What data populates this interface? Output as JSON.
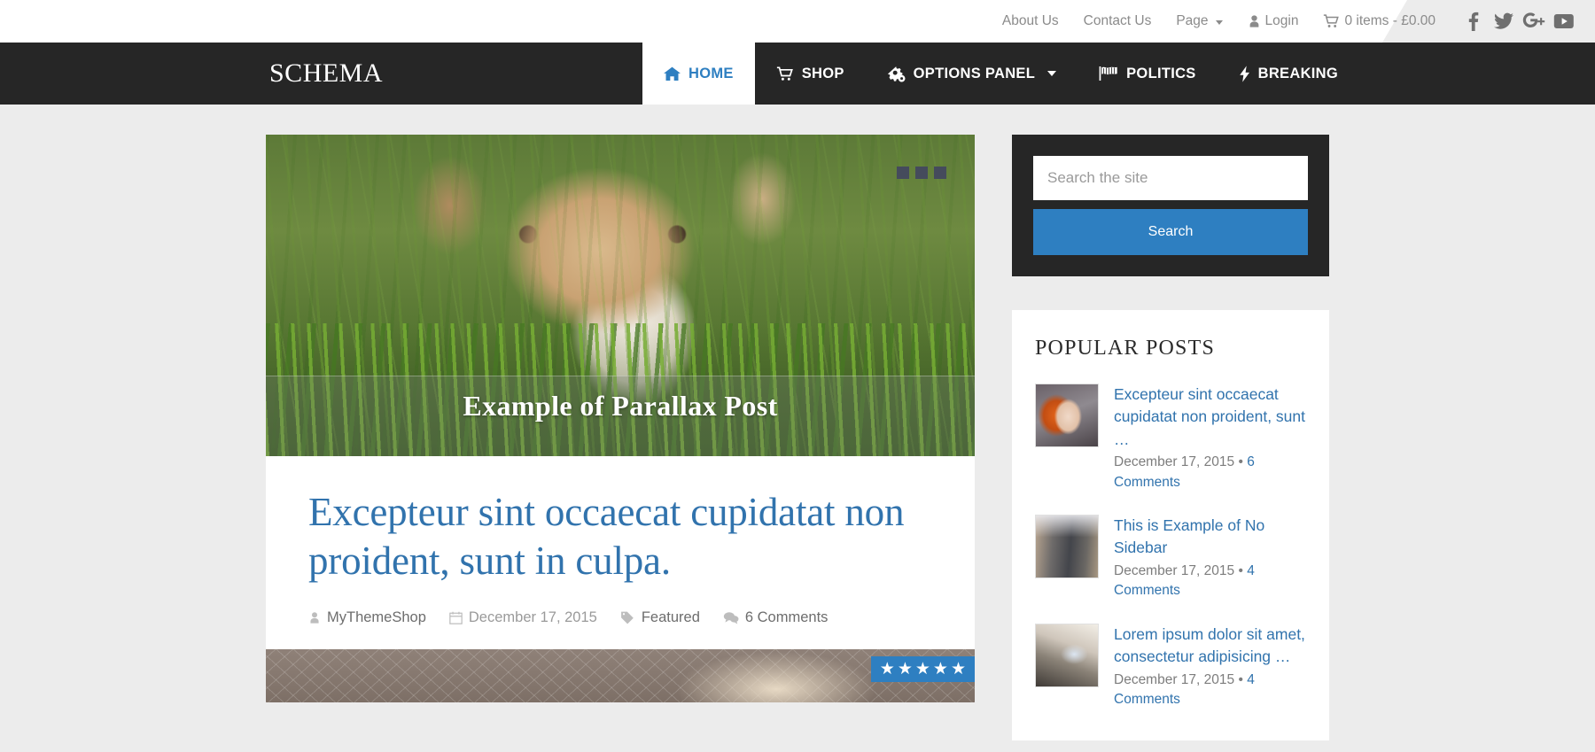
{
  "topbar": {
    "links": [
      {
        "label": "About Us",
        "icon": "",
        "caret": false
      },
      {
        "label": "Contact Us",
        "icon": "",
        "caret": false
      },
      {
        "label": "Page",
        "icon": "",
        "caret": true
      },
      {
        "label": "Login",
        "icon": "user-icon",
        "caret": false
      },
      {
        "label": "0 items - £0.00",
        "icon": "cart-icon",
        "caret": false
      }
    ],
    "social": [
      {
        "name": "facebook-icon",
        "label": "Facebook"
      },
      {
        "name": "twitter-icon",
        "label": "Twitter"
      },
      {
        "name": "google-plus-icon",
        "label": "Google Plus"
      },
      {
        "name": "youtube-icon",
        "label": "YouTube"
      }
    ]
  },
  "nav": {
    "logo": "SCHEMA",
    "items": [
      {
        "label": "HOME",
        "icon": "home-icon",
        "active": true,
        "caret": false
      },
      {
        "label": "SHOP",
        "icon": "cart-icon",
        "active": false,
        "caret": false
      },
      {
        "label": "OPTIONS PANEL",
        "icon": "gears-icon",
        "active": false,
        "caret": true
      },
      {
        "label": "POLITICS",
        "icon": "flag-icon",
        "active": false,
        "caret": false
      },
      {
        "label": "BREAKING",
        "icon": "bolt-icon",
        "active": false,
        "caret": false
      }
    ]
  },
  "hero": {
    "title": "Example of Parallax Post",
    "slider_dots": 3
  },
  "article": {
    "title": "Excepteur sint occaecat cupidatat non proident, sunt in culpa.",
    "meta": {
      "author": "MyThemeShop",
      "date": "December 17, 2015",
      "category": "Featured",
      "comments": "6 Comments"
    },
    "rating_stars": 5,
    "rating_star_glyph": "★"
  },
  "sidebar": {
    "search": {
      "placeholder": "Search the site",
      "value": "",
      "button_label": "Search"
    },
    "popular": {
      "heading": "POPULAR POSTS",
      "items": [
        {
          "title": "Excepteur sint occaecat cupidatat non proident, sunt …",
          "date": "December 17, 2015",
          "separator": "•",
          "comments": "6 Comments",
          "thumb": "woman-portrait"
        },
        {
          "title": "This is Example of No Sidebar",
          "date": "December 17, 2015",
          "separator": "•",
          "comments": "4 Comments",
          "thumb": "bridge-walkway"
        },
        {
          "title": "Lorem ipsum dolor sit amet, consectetur adipisicing …",
          "date": "December 17, 2015",
          "separator": "•",
          "comments": "4 Comments",
          "thumb": "laptop-desk"
        }
      ]
    }
  },
  "colors": {
    "accent": "#2e7fc1",
    "link": "#3173ad",
    "nav_bg": "#262626",
    "page_bg": "#ececec"
  }
}
